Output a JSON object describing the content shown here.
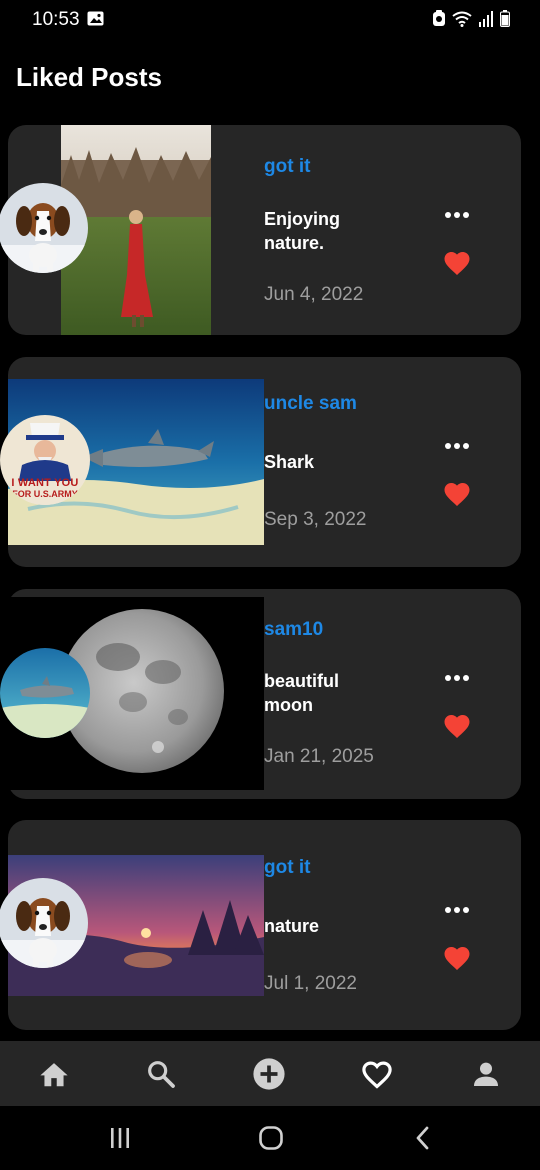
{
  "status_bar": {
    "time": "10:53",
    "left_icons": [
      "image-icon"
    ],
    "right_icons": [
      "alarm-icon",
      "wifi-icon",
      "signal-icon",
      "battery-icon"
    ]
  },
  "header": {
    "title": "Liked Posts"
  },
  "posts": [
    {
      "username": "got it",
      "caption": "Enjoying nature.",
      "date": "Jun 4, 2022",
      "liked": true,
      "image": "woman-in-red-dress-on-meadow",
      "avatar": "beagle-puppy"
    },
    {
      "username": "uncle sam",
      "caption": "Shark",
      "date": "Sep 3, 2022",
      "liked": true,
      "image": "shark-underwater",
      "avatar": "uncle-sam-poster"
    },
    {
      "username": "sam10",
      "caption": "beautiful moon",
      "date": "Jan 21, 2025",
      "liked": true,
      "image": "full-moon",
      "avatar": "shark-underwater"
    },
    {
      "username": "got it",
      "caption": "nature",
      "date": "Jul 1, 2022",
      "liked": true,
      "image": "sunset-landscape",
      "avatar": "beagle-puppy"
    }
  ],
  "uncle_sam_poster_text": [
    "I WANT YOU",
    "FOR U.S.ARMY"
  ],
  "bottom_nav": {
    "items": [
      {
        "name": "home",
        "icon": "home-icon",
        "active": false
      },
      {
        "name": "search",
        "icon": "search-icon",
        "active": false
      },
      {
        "name": "add",
        "icon": "add-circle-icon",
        "active": false
      },
      {
        "name": "liked",
        "icon": "heart-outline-icon",
        "active": true
      },
      {
        "name": "profile",
        "icon": "person-icon",
        "active": false
      }
    ]
  },
  "system_nav": {
    "buttons": [
      "recents-icon",
      "home-circle-icon",
      "back-icon"
    ]
  },
  "colors": {
    "background": "#000000",
    "card": "#262626",
    "username": "#1e88e5",
    "date": "#9e9e9e",
    "heart": "#f44336",
    "nav_icon": "#cfcfcf"
  }
}
